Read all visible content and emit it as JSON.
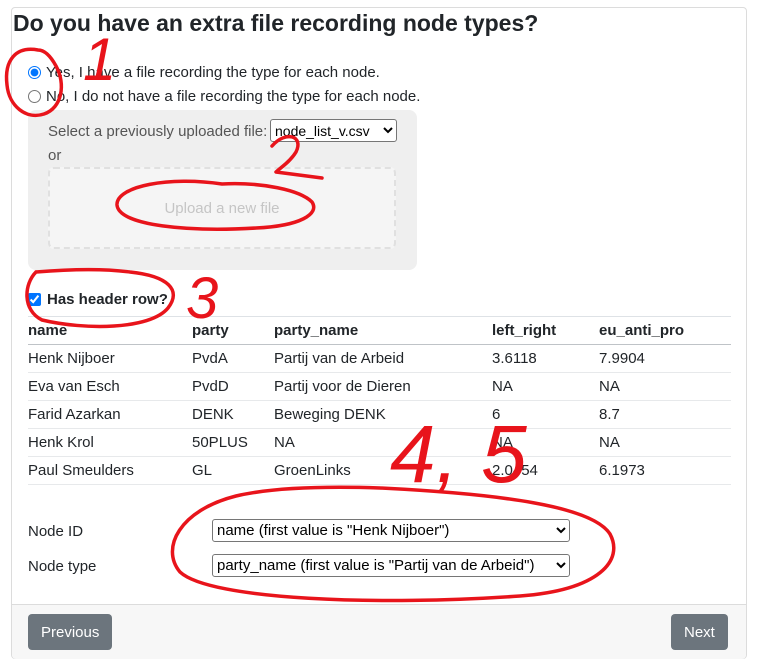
{
  "question": {
    "title": "Do you have an extra file recording node types?"
  },
  "radios": {
    "yes_label": "Yes, I have a file recording the type for each node.",
    "no_label": "No, I do not have a file recording the type for each node."
  },
  "upload": {
    "select_label": "Select a previously uploaded file:",
    "selected_file": "node_list_v.csv",
    "or_text": "or",
    "dropzone_label": "Upload a new file"
  },
  "header_checkbox": {
    "label": "Has header row?",
    "checked": true
  },
  "preview_table": {
    "columns": [
      "name",
      "party",
      "party_name",
      "left_right",
      "eu_anti_pro"
    ],
    "rows": [
      [
        "Henk Nijboer",
        "PvdA",
        "Partij van de Arbeid",
        "3.6118",
        "7.9904"
      ],
      [
        "Eva van Esch",
        "PvdD",
        "Partij voor de Dieren",
        "NA",
        "NA"
      ],
      [
        "Farid Azarkan",
        "DENK",
        "Beweging DENK",
        "6",
        "8.7"
      ],
      [
        "Henk Krol",
        "50PLUS",
        "NA",
        "NA",
        "NA"
      ],
      [
        "Paul Smeulders",
        "GL",
        "GroenLinks",
        "2.0454",
        "6.1973"
      ]
    ]
  },
  "mapping": {
    "node_id_label": "Node ID",
    "node_id_value": "name (first value is \"Henk Nijboer\")",
    "node_type_label": "Node type",
    "node_type_value": "party_name (first value is \"Partij van de Arbeid\")"
  },
  "footer": {
    "previous_label": "Previous",
    "next_label": "Next"
  },
  "annotations": {
    "mark1": "1",
    "mark2": "2",
    "mark3": "3",
    "mark45": "4, 5",
    "color": "#e8141b"
  },
  "colors": {
    "button": "#6c757d",
    "panel": "#efefef"
  }
}
